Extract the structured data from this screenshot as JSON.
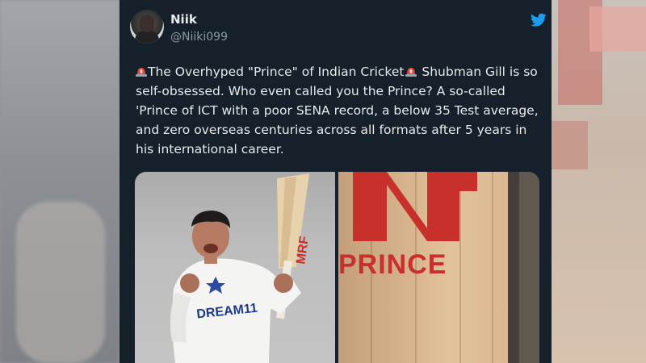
{
  "tweet": {
    "display_name": "Niik",
    "handle": "@Niiki099",
    "text_intro": "The Overhyped \"Prince\" of Indian Cricket",
    "text_rest": " Shubman Gill is so self-obsessed. Who even called you the Prince? A so-called 'Prince of ICT with a poor SENA record, a below 35 Test average, and zero overseas centuries across all formats after 5 years in his international career.",
    "emoji": "siren-emoji"
  },
  "media": {
    "left_image": {
      "description_icon": "player-photo",
      "jersey_text": "DREAM11",
      "bat_brand": "MRF"
    },
    "right_image": {
      "label": "PRINCE"
    }
  },
  "colors": {
    "card_bg": "#15202b",
    "twitter_blue": "#1d9bf0",
    "text_primary": "#e7e9ea",
    "text_secondary": "#8b98a5",
    "brand_red": "#c8302c"
  },
  "icons": {
    "logo": "twitter-bird-icon"
  }
}
